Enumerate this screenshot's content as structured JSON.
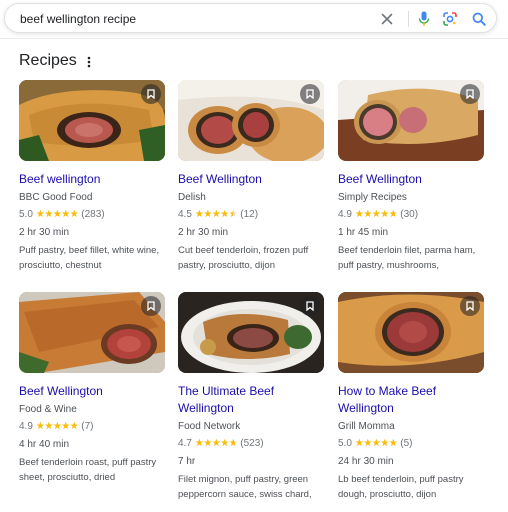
{
  "search": {
    "query": "beef wellington recipe"
  },
  "icons": {
    "clear": "close-icon",
    "voice": "microphone-icon",
    "lens": "camera-lens-icon",
    "search": "search-icon",
    "more": "more-vert-icon",
    "bookmark": "bookmark-icon"
  },
  "colors": {
    "link": "#1a0dab",
    "star": "#fbbc04",
    "search_blue": "#4285f4"
  },
  "section": {
    "title": "Recipes"
  },
  "recipes": [
    {
      "title": "Beef wellington",
      "source": "BBC Good Food",
      "rating": "5.0",
      "stars": 5.0,
      "reviews": "(283)",
      "time": "2 hr 30 min",
      "ingredients": "Puff pastry, beef fillet, white wine, prosciutto, chestnut"
    },
    {
      "title": "Beef Wellington",
      "source": "Delish",
      "rating": "4.5",
      "stars": 4.5,
      "reviews": "(12)",
      "time": "2 hr 30 min",
      "ingredients": "Cut beef tenderloin, frozen puff pastry, prosciutto, dijon"
    },
    {
      "title": "Beef Wellington",
      "source": "Simply Recipes",
      "rating": "4.9",
      "stars": 4.9,
      "reviews": "(30)",
      "time": "1 hr 45 min",
      "ingredients": "Beef tenderloin filet, parma ham, puff pastry, mushrooms,"
    },
    {
      "title": "Beef Wellington",
      "source": "Food & Wine",
      "rating": "4.9",
      "stars": 4.9,
      "reviews": "(7)",
      "time": "4 hr 40 min",
      "ingredients": "Beef tenderloin roast, puff pastry sheet, prosciutto, dried"
    },
    {
      "title": "The Ultimate Beef Wellington",
      "source": "Food Network",
      "rating": "4.7",
      "stars": 4.7,
      "reviews": "(523)",
      "time": "7 hr",
      "ingredients": "Filet mignon, puff pastry, green peppercorn sauce, swiss chard,"
    },
    {
      "title": "How to Make Beef Wellington",
      "source": "Grill Momma",
      "rating": "5.0",
      "stars": 5.0,
      "reviews": "(5)",
      "time": "24 hr 30 min",
      "ingredients": "Lb beef tenderloin, puff pastry dough, prosciutto, dijon"
    }
  ]
}
